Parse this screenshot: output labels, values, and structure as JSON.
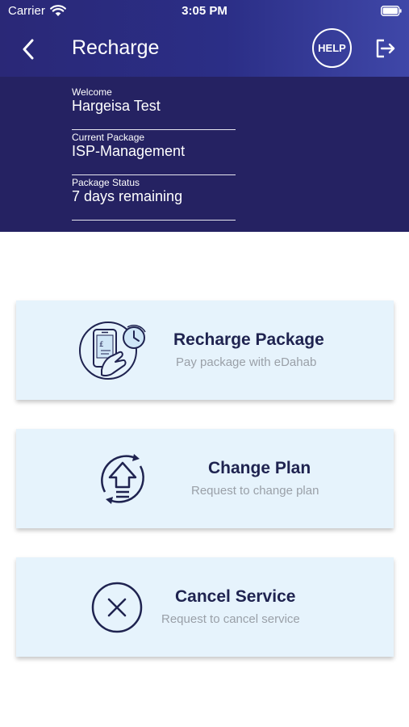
{
  "status_bar": {
    "carrier": "Carrier",
    "time": "3:05 PM"
  },
  "header": {
    "title": "Recharge",
    "help_label": "HELP"
  },
  "account": {
    "fields": [
      {
        "label": "Welcome",
        "value": "Hargeisa Test"
      },
      {
        "label": "Current Package",
        "value": "ISP-Management"
      },
      {
        "label": "Package Status",
        "value": "7 days remaining"
      }
    ]
  },
  "actions": [
    {
      "title": "Recharge Package",
      "subtitle": "Pay package with eDahab",
      "icon": "phone-payment-icon"
    },
    {
      "title": "Change Plan",
      "subtitle": "Request to change plan",
      "icon": "upgrade-arrow-icon"
    },
    {
      "title": "Cancel Service",
      "subtitle": "Request to cancel service",
      "icon": "cancel-circle-icon"
    }
  ],
  "colors": {
    "header": "#2b2e86",
    "panel": "#252262",
    "card": "#e6f3fc",
    "text_dark": "#1f2350",
    "text_muted": "#9aa0a8"
  }
}
